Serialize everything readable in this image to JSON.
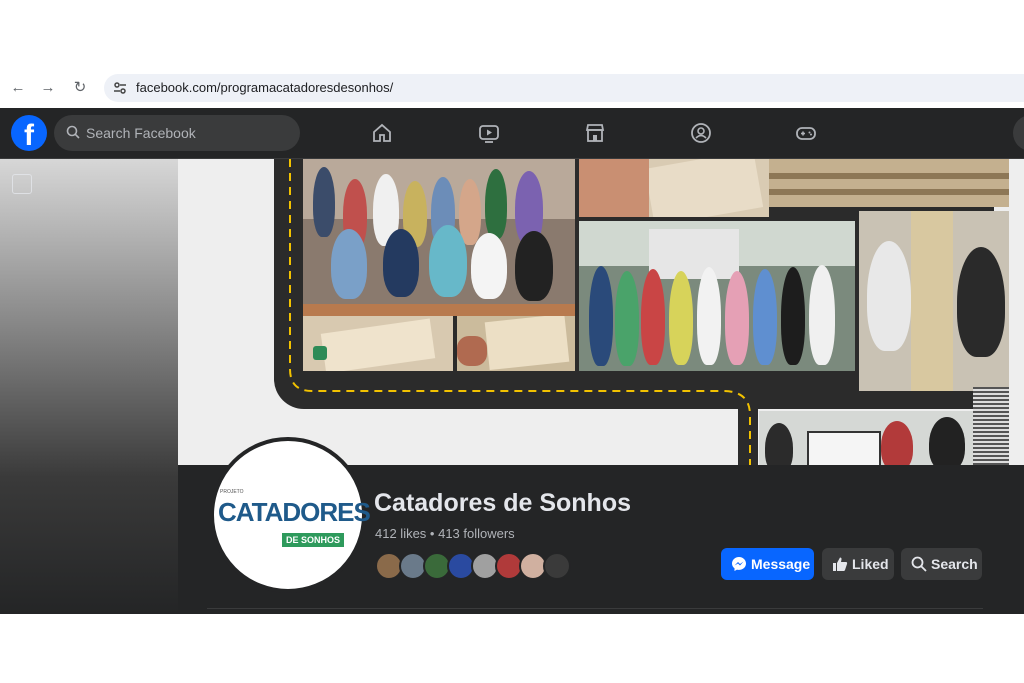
{
  "browser": {
    "url": "facebook.com/programacatadoresdesonhos/"
  },
  "facebook": {
    "logo_letter": "f",
    "search_placeholder": "Search Facebook",
    "nav": [
      {
        "icon": "home-icon"
      },
      {
        "icon": "video-icon"
      },
      {
        "icon": "marketplace-icon"
      },
      {
        "icon": "groups-icon"
      },
      {
        "icon": "gaming-icon"
      }
    ]
  },
  "page": {
    "name": "Catadores de Sonhos",
    "stats": "412 likes • 413 followers",
    "logo": {
      "top_text": "PROJETO",
      "main_text": "CATADORES",
      "sub_text": "DE SONHOS"
    },
    "buttons": {
      "message": "Message",
      "liked": "Liked",
      "search": "Search"
    },
    "colors": {
      "accent": "#0866ff",
      "dark_bg": "#242526",
      "button_bg": "#3a3b3c",
      "logo_green": "#2e9a5c"
    }
  }
}
